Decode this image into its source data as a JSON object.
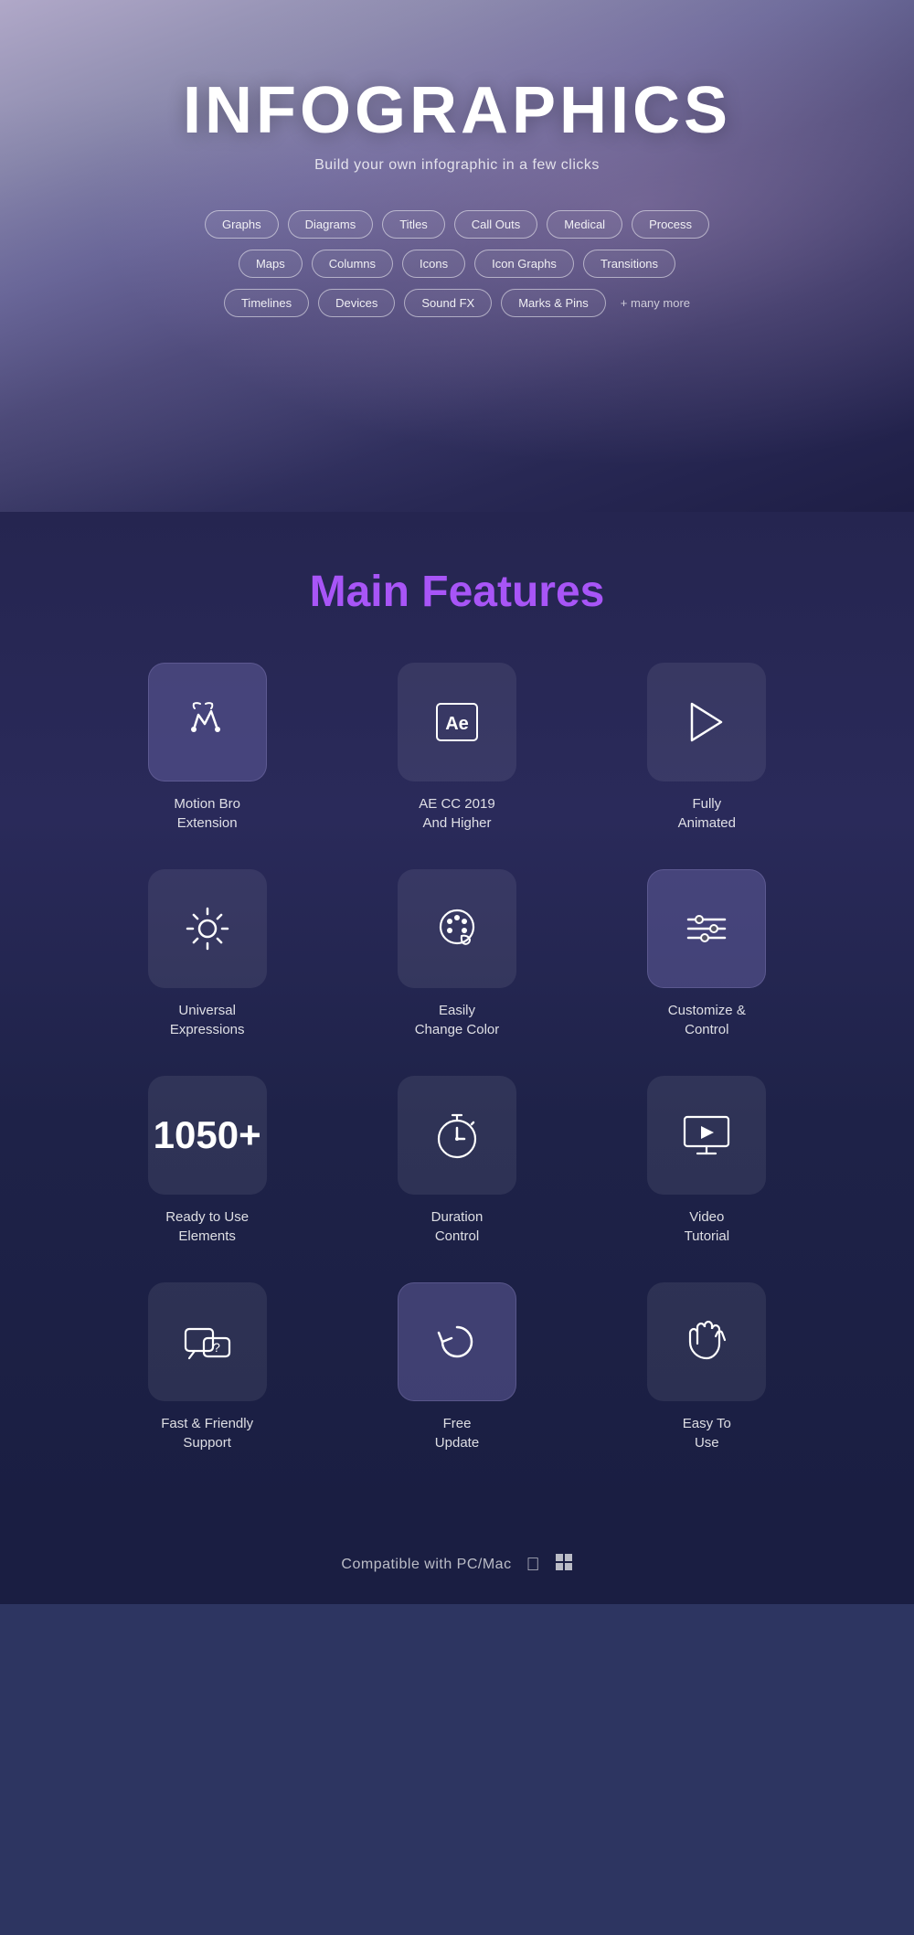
{
  "hero": {
    "title": "INFOGRAPHICS",
    "subtitle": "Build your own infographic in a few clicks",
    "tags_row1": [
      "Graphs",
      "Diagrams",
      "Titles",
      "Call Outs",
      "Medical",
      "Process"
    ],
    "tags_row2": [
      "Maps",
      "Columns",
      "Icons",
      "Icon Graphs",
      "Transitions"
    ],
    "tags_row3": [
      "Timelines",
      "Devices",
      "Sound FX",
      "Marks & Pins"
    ],
    "more_text": "+ many more"
  },
  "features": {
    "title_plain": "Main ",
    "title_accent": "Features",
    "items": [
      {
        "id": "motion-bro",
        "label": "Motion Bro\nExtension",
        "icon": "motion-bro-icon",
        "highlighted": true
      },
      {
        "id": "ae-cc",
        "label": "AE CC 2019\nAnd Higher",
        "icon": "ae-icon",
        "highlighted": false
      },
      {
        "id": "fully-animated",
        "label": "Fully\nAnimated",
        "icon": "play-icon",
        "highlighted": false
      },
      {
        "id": "universal",
        "label": "Universal\nExpressions",
        "icon": "gear-icon",
        "highlighted": false
      },
      {
        "id": "change-color",
        "label": "Easily\nChange Color",
        "icon": "palette-icon",
        "highlighted": false
      },
      {
        "id": "customize",
        "label": "Customize &\nControl",
        "icon": "sliders-icon",
        "highlighted": true
      },
      {
        "id": "elements",
        "label": "Ready to Use\nElements",
        "icon": "1050+",
        "highlighted": true,
        "is_number": true
      },
      {
        "id": "duration",
        "label": "Duration\nControl",
        "icon": "stopwatch-icon",
        "highlighted": false
      },
      {
        "id": "tutorial",
        "label": "Video\nTutorial",
        "icon": "monitor-icon",
        "highlighted": false
      },
      {
        "id": "support",
        "label": "Fast & Friendly\nSupport",
        "icon": "support-icon",
        "highlighted": false
      },
      {
        "id": "update",
        "label": "Free\nUpdate",
        "icon": "update-icon",
        "highlighted": true
      },
      {
        "id": "easy",
        "label": "Easy To\nUse",
        "icon": "hand-icon",
        "highlighted": false
      }
    ]
  },
  "compatible": {
    "text": "Compatible with PC/Mac"
  }
}
